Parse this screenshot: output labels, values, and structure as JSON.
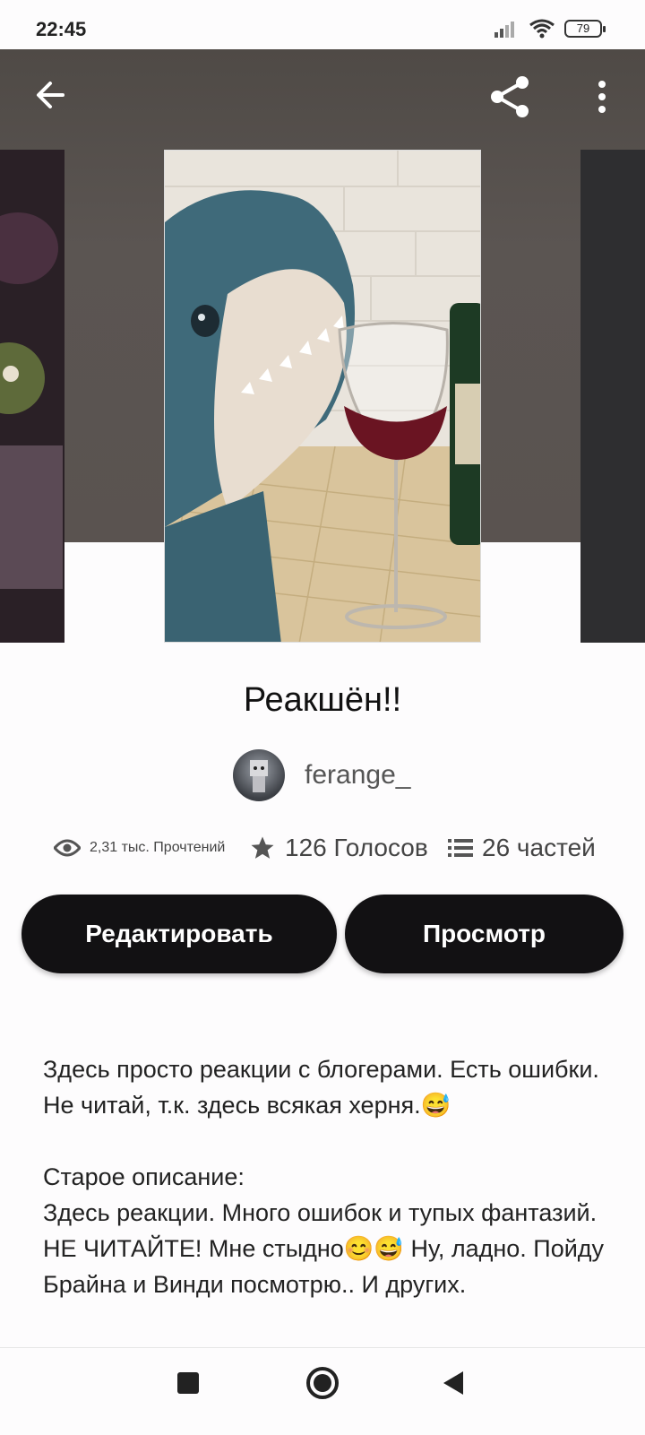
{
  "status_bar": {
    "time": "22:45",
    "battery": "79",
    "icons": [
      "signal-icon",
      "wifi-icon",
      "battery-icon"
    ]
  },
  "header": {
    "icons": [
      "back-arrow-icon",
      "share-icon",
      "more-vert-icon"
    ]
  },
  "story": {
    "title": "Реакшён!!",
    "author": "ferange_",
    "stats": {
      "reads": "2,31 тыс. Прочтений",
      "votes": "126 Голосов",
      "parts": "26 частей"
    },
    "buttons": {
      "edit": "Редактировать",
      "view": "Просмотр"
    },
    "description": "Здесь просто реакции с блогерами. Есть ошибки. Не читай, т.к. здесь всякая херня.😅\n\nСтарое описание:\nЗдесь реакции. Много ошибок и тупых фантазий. НЕ ЧИТАЙТЕ! Мне стыдно😊😅 Ну, ладно. Пойду Брайна и Винди посмотрю.. И других."
  },
  "nav_bar": {
    "icons": [
      "recents-square-icon",
      "home-circle-icon",
      "back-triangle-icon"
    ]
  },
  "colors": {
    "hero_bg": "#5a5350",
    "button_bg": "#121113",
    "page_bg": "#fdfcfd"
  }
}
